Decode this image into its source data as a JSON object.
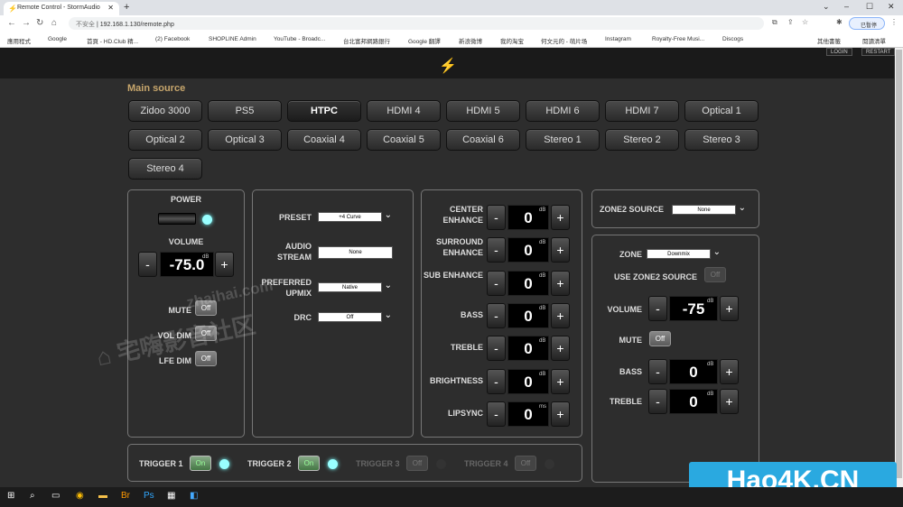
{
  "browser": {
    "tab_title": "Remote Control - StormAudio",
    "new_tab": "+",
    "insecure_label": "不安全",
    "url": "192.168.1.130/remote.php",
    "profile_label": "已暫停",
    "win_min": "–",
    "win_max": "☐",
    "win_close": "✕",
    "tab_close": "✕",
    "bookmarks": [
      "應用程式",
      "Google",
      "首頁 - HD.Club 精...",
      "(2) Facebook",
      "SHOPLINE Admin",
      "YouTube - Broadc...",
      "台北富邦網路銀行",
      "Google 翻譯",
      "新浪微博",
      "我的淘宝",
      "何文元的 - 萌片场",
      "Instagram",
      "Royalty-Free Musi...",
      "Discogs",
      "其他書籤",
      "閱讀清單"
    ]
  },
  "header": {
    "login": "LOGIN",
    "restart": "RESTART",
    "logo_icon": "lightning-icon"
  },
  "main_source": {
    "title": "Main source",
    "buttons": [
      "Zidoo 3000",
      "PS5",
      "HTPC",
      "HDMI 4",
      "HDMI 5",
      "HDMI 6",
      "HDMI 7",
      "Optical 1",
      "Optical 2",
      "Optical 3",
      "Coaxial 4",
      "Coaxial 5",
      "Coaxial 6",
      "Stereo 1",
      "Stereo 2",
      "Stereo 3",
      "Stereo 4"
    ],
    "selected": "HTPC"
  },
  "power": {
    "power_label": "POWER",
    "volume_label": "VOLUME",
    "volume_value": "-75.0",
    "volume_unit": "dB",
    "minus": "-",
    "plus": "+",
    "mute_label": "MUTE",
    "mute_value": "Off",
    "voldim_label": "VOL DIM",
    "voldim_value": "Off",
    "lfedim_label": "LFE DIM",
    "lfedim_value": "Off"
  },
  "settings": {
    "preset_label": "PRESET",
    "preset_value": "+4 Curve",
    "audio_stream_label": "AUDIO STREAM",
    "audio_stream_value": "None",
    "upmix_label": "PREFERRED UPMIX",
    "upmix_value": "Native",
    "drc_label": "DRC",
    "drc_value": "Off"
  },
  "tone": {
    "unit": "dB",
    "lipsync_unit": "ms",
    "rows": [
      {
        "label": "CENTER ENHANCE",
        "value": "0"
      },
      {
        "label": "SURROUND ENHANCE",
        "value": "0"
      },
      {
        "label": "SUB ENHANCE",
        "value": "0"
      },
      {
        "label": "BASS",
        "value": "0"
      },
      {
        "label": "TREBLE",
        "value": "0"
      },
      {
        "label": "BRIGHTNESS",
        "value": "0"
      },
      {
        "label": "LIPSYNC",
        "value": "0"
      }
    ]
  },
  "zone2": {
    "source_label": "ZONE2 SOURCE",
    "source_value": "None",
    "zone_label": "ZONE",
    "zone_value": "Downmix",
    "use_z2_label": "USE ZONE2 SOURCE",
    "use_z2_value": "Off",
    "volume_label": "VOLUME",
    "volume_value": "-75",
    "mute_label": "MUTE",
    "mute_value": "Off",
    "bass_label": "BASS",
    "bass_value": "0",
    "treble_label": "TREBLE",
    "treble_value": "0",
    "unit": "dB"
  },
  "triggers": [
    {
      "label": "TRIGGER 1",
      "value": "On",
      "state": "on"
    },
    {
      "label": "TRIGGER 2",
      "value": "On",
      "state": "on"
    },
    {
      "label": "TRIGGER 3",
      "value": "Off",
      "state": "disabled"
    },
    {
      "label": "TRIGGER 4",
      "value": "Off",
      "state": "disabled"
    }
  ],
  "overlay": {
    "watermark": "宅嗨影音社区",
    "watermark_small": "zhaihai.com",
    "hao4k": "Hao4K.CN"
  }
}
